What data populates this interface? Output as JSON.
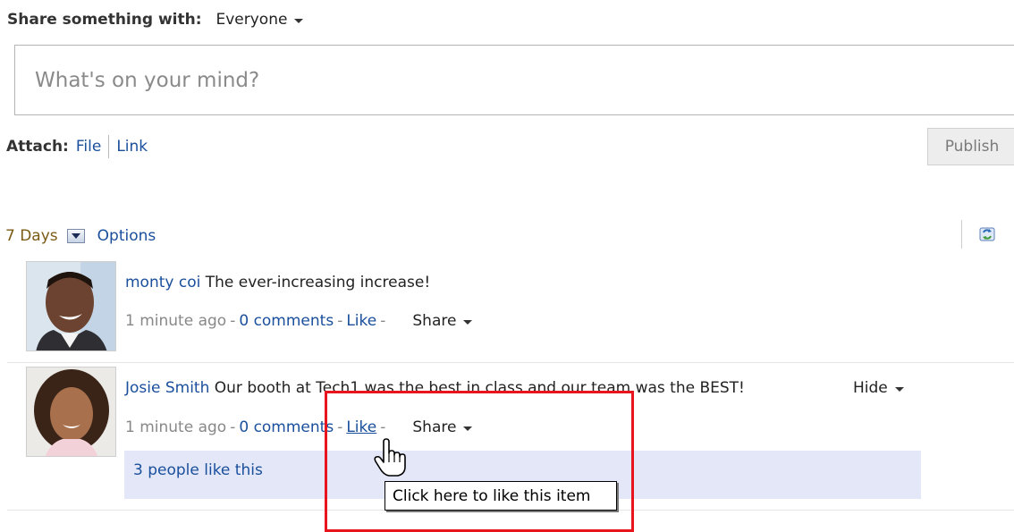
{
  "share": {
    "label": "Share something with:",
    "audience": "Everyone"
  },
  "status": {
    "placeholder": "What's on your mind?"
  },
  "attach": {
    "label": "Attach:",
    "file": "File",
    "link": "Link"
  },
  "publish": {
    "label": "Publish"
  },
  "filter": {
    "days": "7 Days",
    "options": "Options"
  },
  "posts": [
    {
      "author": "monty coi",
      "text": "The ever-increasing increase!",
      "time": "1 minute ago",
      "comments": "0 comments",
      "like": "Like",
      "share": "Share",
      "dash": "-"
    },
    {
      "author": "Josie Smith",
      "text": "Our booth at Tech1 was the best in class and our team was the BEST!",
      "time": "1 minute ago",
      "comments": "0 comments",
      "like": "Like",
      "share": "Share",
      "hide": "Hide",
      "likes": "3 people like this",
      "dash": "-"
    }
  ],
  "tooltip": {
    "text": "Click here to like this item"
  },
  "colors": {
    "link": "#1a4f9c",
    "highlight": "#e8151d",
    "likes_bg": "#e3e7f8"
  },
  "icons": [
    "refresh-icon",
    "dropdown-icon",
    "hand-cursor-icon"
  ]
}
